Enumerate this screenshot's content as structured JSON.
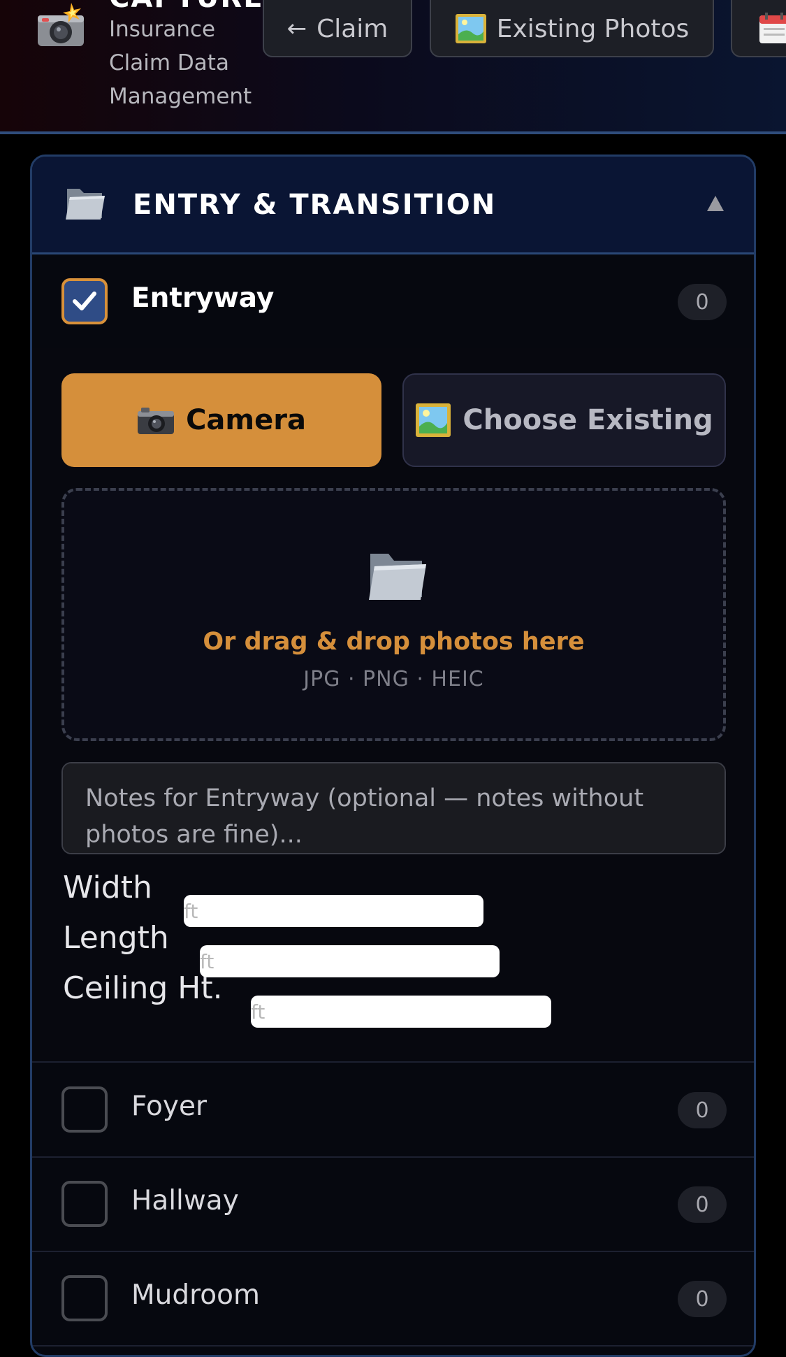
{
  "header": {
    "app_title": "CAPTURE",
    "app_subtitle": "Insurance Claim Data Management",
    "nav": {
      "claim_label": "Claim",
      "photos_label": "Existing Photos"
    }
  },
  "section": {
    "title": "ENTRY & TRANSITION",
    "collapse_icon": "triangle-up-icon"
  },
  "active_room": {
    "name": "Entryway",
    "checked": true,
    "count": "0",
    "camera_label": "Camera",
    "choose_existing_label": "Choose Existing",
    "dropzone_text": "Or drag & drop photos here",
    "dropzone_formats": "JPG · PNG · HEIC",
    "notes_placeholder": "Notes for Entryway (optional — notes without photos are fine)...",
    "dimensions": {
      "width_label": "Width",
      "length_label": "Length",
      "ceiling_label": "Ceiling Ht.",
      "unit_placeholder": "ft"
    }
  },
  "rooms": [
    {
      "name": "Foyer",
      "count": "0",
      "checked": false
    },
    {
      "name": "Hallway",
      "count": "0",
      "checked": false
    },
    {
      "name": "Mudroom",
      "count": "0",
      "checked": false
    }
  ],
  "colors": {
    "accent_orange": "#d58f3b",
    "checkbox_fill": "#2f4c86",
    "header_border": "#2f4d7c",
    "card_border": "#223c66"
  }
}
